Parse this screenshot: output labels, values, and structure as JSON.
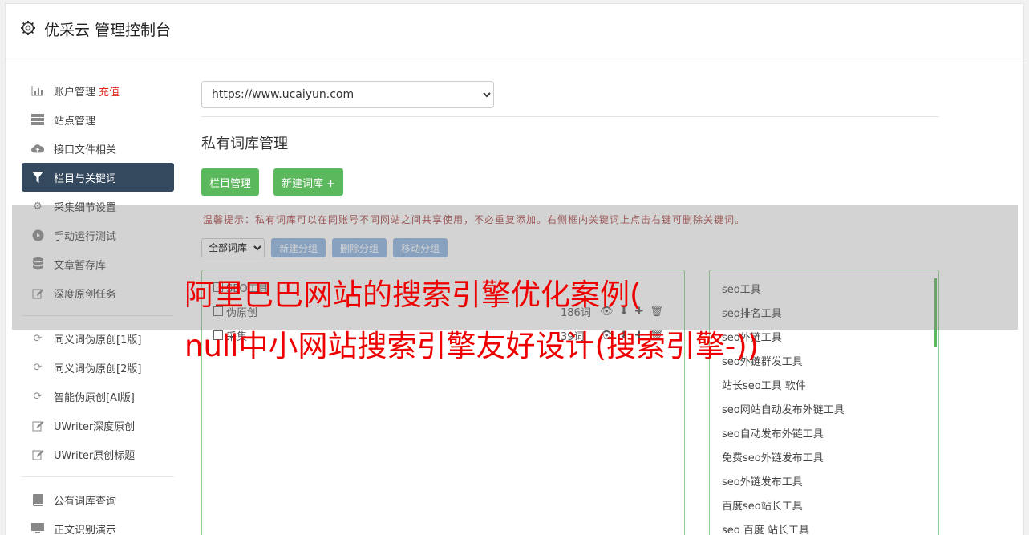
{
  "header": {
    "title": "优采云 管理控制台",
    "icon": "gear-icon"
  },
  "sidebar": {
    "items": [
      {
        "label": "账户管理",
        "badge": "充值",
        "icon": "bar-chart-icon"
      },
      {
        "label": "站点管理",
        "icon": "server-icon"
      },
      {
        "label": "接口文件相关",
        "icon": "cloud-upload-icon"
      },
      {
        "label": "栏目与关键词",
        "icon": "filter-icon",
        "active": true
      },
      {
        "label": "采集细节设置",
        "icon": "gears-icon"
      },
      {
        "label": "手动运行测试",
        "icon": "play-circle-icon"
      },
      {
        "label": "文章暂存库",
        "icon": "database-icon"
      },
      {
        "label": "深度原创任务",
        "icon": "edit-icon"
      },
      {
        "label": "同义词伪原创[1版]",
        "icon": "refresh-icon"
      },
      {
        "label": "同义词伪原创[2版]",
        "icon": "refresh-icon"
      },
      {
        "label": "智能伪原创[AI版]",
        "icon": "refresh-icon"
      },
      {
        "label": "UWriter深度原创",
        "icon": "edit-icon"
      },
      {
        "label": "UWriter原创标题",
        "icon": "edit-icon"
      },
      {
        "label": "公有词库查询",
        "icon": "book-icon"
      },
      {
        "label": "正文识别演示",
        "icon": "monitor-icon"
      }
    ]
  },
  "main": {
    "site_select": "https://www.ucaiyun.com",
    "section_title": "私有词库管理",
    "btn_columns": "栏目管理",
    "btn_new_lib": "新建词库 +",
    "tip": "温馨提示：私有词库可以在同账号不同网站之间共享使用，不必重复添加。右侧框内关键词上点击右键可删除关键词。",
    "lib_select": "全部词库",
    "btn_new_group": "新建分组",
    "btn_del_group": "删除分组",
    "btn_move_group": "移动分组",
    "groups": [
      {
        "name": "SEO工具",
        "count": ""
      },
      {
        "name": "伪原创",
        "count": "186词"
      },
      {
        "name": "采集",
        "count": "39词"
      }
    ],
    "keywords": [
      "seo工具",
      "seo排名工具",
      "seo外链工具",
      "seo外链群发工具",
      "站长seo工具 软件",
      "seo网站自动发布外链工具",
      "seo自动发布外链工具",
      "免费seo外链发布工具",
      "seo外链发布工具",
      "百度seo站长工具",
      "seo 百度 站长工具"
    ]
  },
  "overlay": {
    "line1": "阿里巴巴网站的搜索引擎优化案例(",
    "line2": "null中小网站搜索引擎友好设计(搜索引擎-))"
  },
  "colors": {
    "active_nav": "#34495e",
    "green": "#5cb85c",
    "blue_btn": "#8cb3e0",
    "headline": "#ee0000",
    "badge": "#e0231a"
  }
}
